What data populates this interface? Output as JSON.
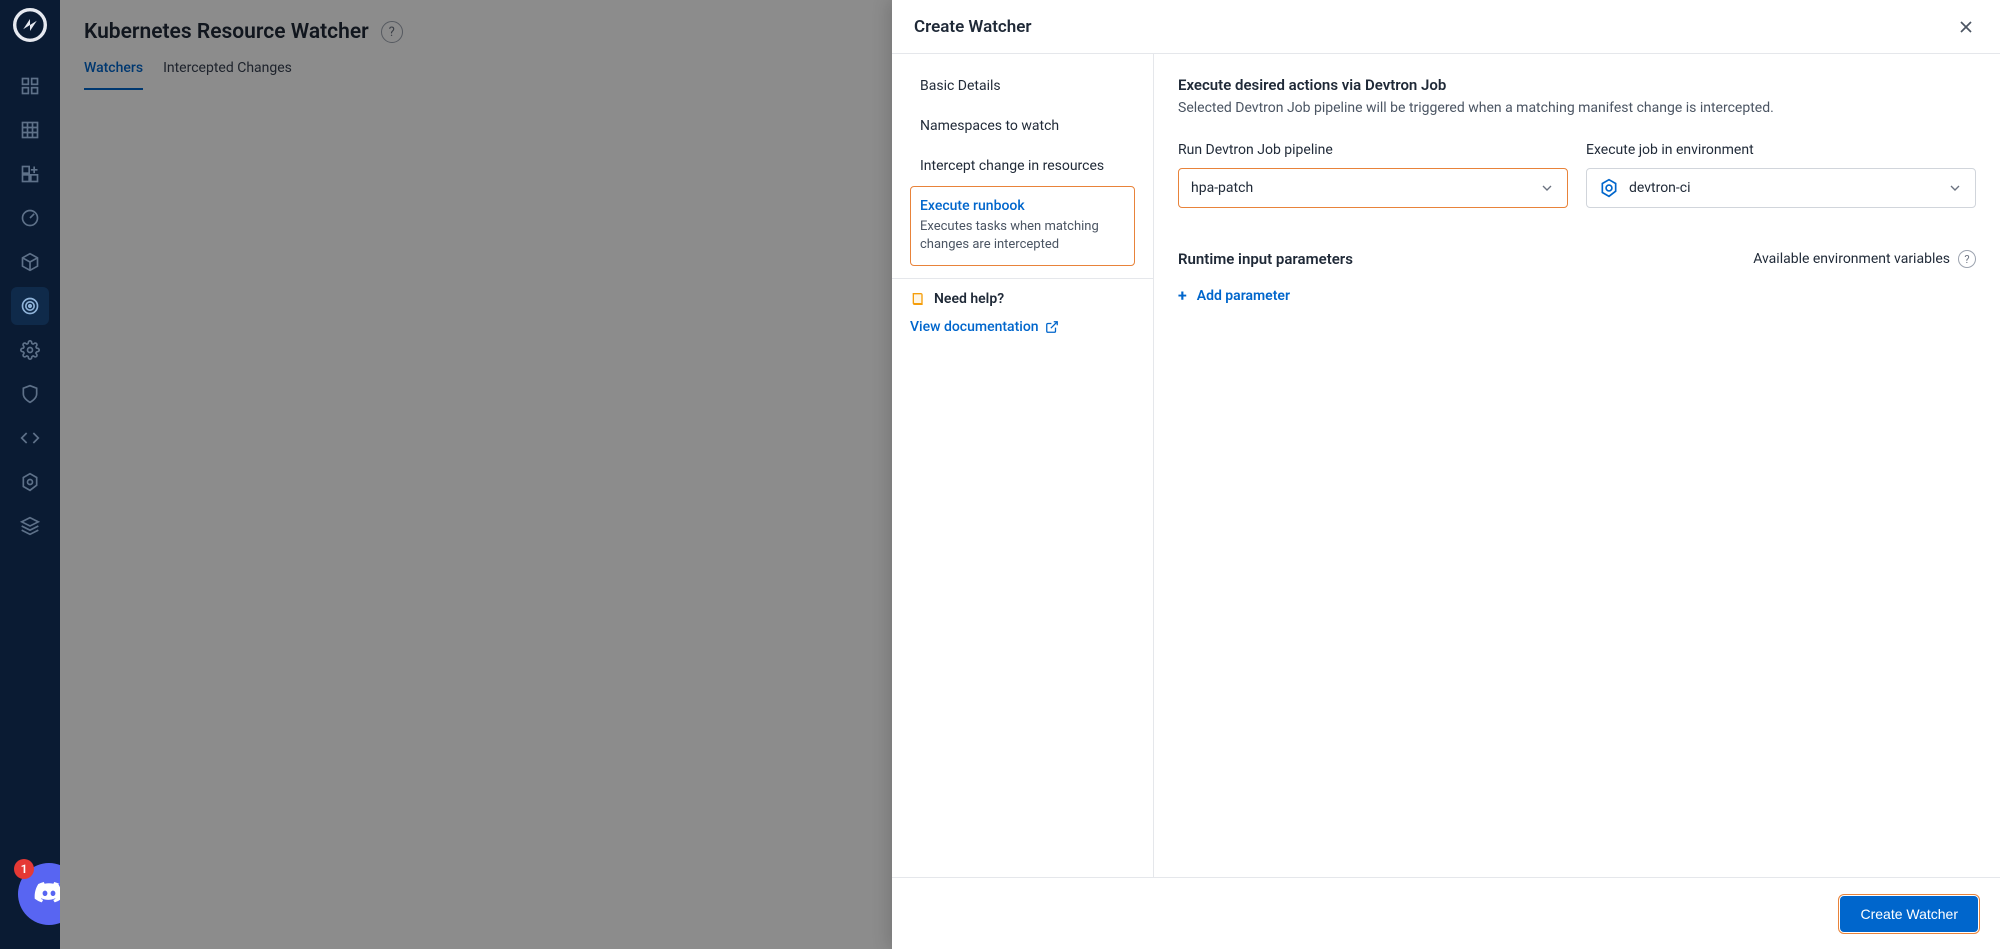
{
  "rail": {
    "discord_badge": "1"
  },
  "page": {
    "title": "Kubernetes Resource Watcher",
    "tabs": [
      {
        "label": "Watchers",
        "active": true
      },
      {
        "label": "Intercepted Changes",
        "active": false
      }
    ]
  },
  "drawer": {
    "title": "Create Watcher",
    "steps": [
      {
        "label": "Basic Details"
      },
      {
        "label": "Namespaces to watch"
      },
      {
        "label": "Intercept change in resources"
      },
      {
        "label": "Execute runbook",
        "sub": "Executes tasks when matching changes are intercepted",
        "selected": true
      }
    ],
    "help_label": "Need help?",
    "doc_link": "View documentation",
    "content": {
      "section_title": "Execute desired actions via Devtron Job",
      "section_sub": "Selected Devtron Job pipeline will be triggered when a matching manifest change is intercepted.",
      "pipeline_label": "Run Devtron Job pipeline",
      "pipeline_value": "hpa-patch",
      "env_label": "Execute job in environment",
      "env_value": "devtron-ci",
      "params_title": "Runtime input parameters",
      "avail_env_label": "Available environment variables",
      "add_param_label": "Add parameter"
    },
    "create_button": "Create Watcher"
  }
}
